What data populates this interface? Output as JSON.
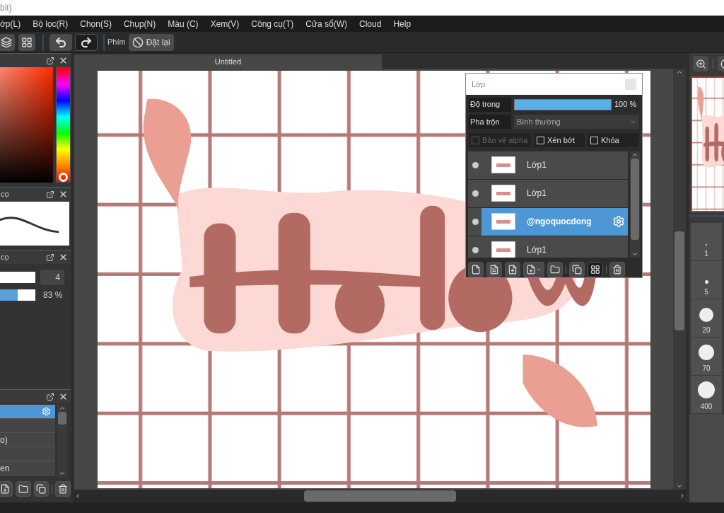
{
  "title_fragment": "bit)",
  "menu": [
    "ớp(L)",
    "Bộ lọc(R)",
    "Chọn(S)",
    "Chụp(N)",
    "Màu (C)",
    "Xem(V)",
    "Công cụ(T)",
    "Cửa sổ(W)",
    "Cloud",
    "Help"
  ],
  "toolbar": {
    "label": "Phím",
    "reset_button": "Đặt lại"
  },
  "document_tabs": [
    {
      "title": "Untitled",
      "selected": true
    }
  ],
  "left_panels": {
    "brush_title": "cọ",
    "size_title": "cọ",
    "size_value": "4",
    "opacity": {
      "level": 0.83,
      "reading": "83 %"
    }
  },
  "mini_layers": [
    {
      "selected": true
    },
    {
      "selected": false
    },
    {
      "label": "o)",
      "selected": false
    },
    {
      "selected": false
    },
    {
      "label": "en",
      "selected": false
    }
  ],
  "layer_window": {
    "title": "Lớp",
    "opacity": {
      "label": "Độ trong",
      "level": 1.0,
      "reading": "100 %"
    },
    "blend": {
      "label": "Pha trộn",
      "value": "Bình thường"
    },
    "options": [
      {
        "label": "Bảo vệ alpha",
        "checked": false,
        "disabled": true
      },
      {
        "label": "Xén bớt",
        "checked": false,
        "disabled": false
      },
      {
        "label": "Khóa",
        "checked": false,
        "disabled": false
      }
    ],
    "layers": [
      {
        "name": "Lớp1",
        "selected": false
      },
      {
        "name": "Lớp1",
        "selected": false
      },
      {
        "name": "@ngoquocdong",
        "selected": true
      },
      {
        "name": "Lớp1",
        "selected": false
      }
    ]
  },
  "brush_sizes": [
    "1",
    "5",
    "20",
    "70",
    "400"
  ]
}
